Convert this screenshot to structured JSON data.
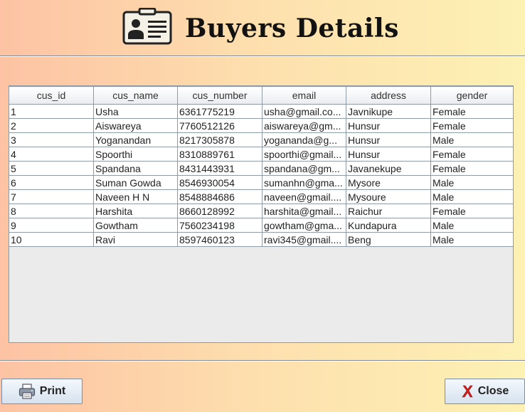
{
  "header": {
    "title": "Buyers Details",
    "icon": "id-card-icon"
  },
  "table": {
    "columns": [
      "cus_id",
      "cus_name",
      "cus_number",
      "email",
      "address",
      "gender"
    ],
    "rows": [
      [
        "1",
        "Usha",
        "6361775219",
        "usha@gmail.co...",
        "Javnikupe",
        "Female"
      ],
      [
        "2",
        "Aiswareya",
        "7760512126",
        "aiswareya@gm...",
        "Hunsur",
        "Female"
      ],
      [
        "3",
        "Yoganandan",
        "8217305878",
        "yogananda@g...",
        "Hunsur",
        "Male"
      ],
      [
        "4",
        "Spoorthi",
        "8310889761",
        "spoorthi@gmail...",
        "Hunsur",
        "Female"
      ],
      [
        "5",
        "Spandana",
        "8431443931",
        "spandana@gm...",
        "Javanekupe",
        "Female"
      ],
      [
        "6",
        "Suman Gowda",
        "8546930054",
        "sumanhn@gma...",
        "Mysore",
        "Male"
      ],
      [
        "7",
        "Naveen H N",
        "8548884686",
        "naveen@gmail....",
        "Mysoure",
        "Male"
      ],
      [
        "8",
        "Harshita",
        "8660128992",
        "harshita@gmail...",
        "Raichur",
        "Female"
      ],
      [
        "9",
        "Gowtham",
        "7560234198",
        "gowtham@gma...",
        "Kundapura",
        "Male"
      ],
      [
        "10",
        "Ravi",
        "8597460123",
        "ravi345@gmail....",
        "Beng",
        "Male"
      ]
    ]
  },
  "buttons": {
    "print_label": "Print",
    "print_icon": "printer-icon",
    "close_label": "Close",
    "close_icon": "x-icon"
  },
  "colors": {
    "bg_left": "#fdc3a4",
    "bg_right": "#fdf1b4",
    "close_icon": "#d21f1f"
  }
}
